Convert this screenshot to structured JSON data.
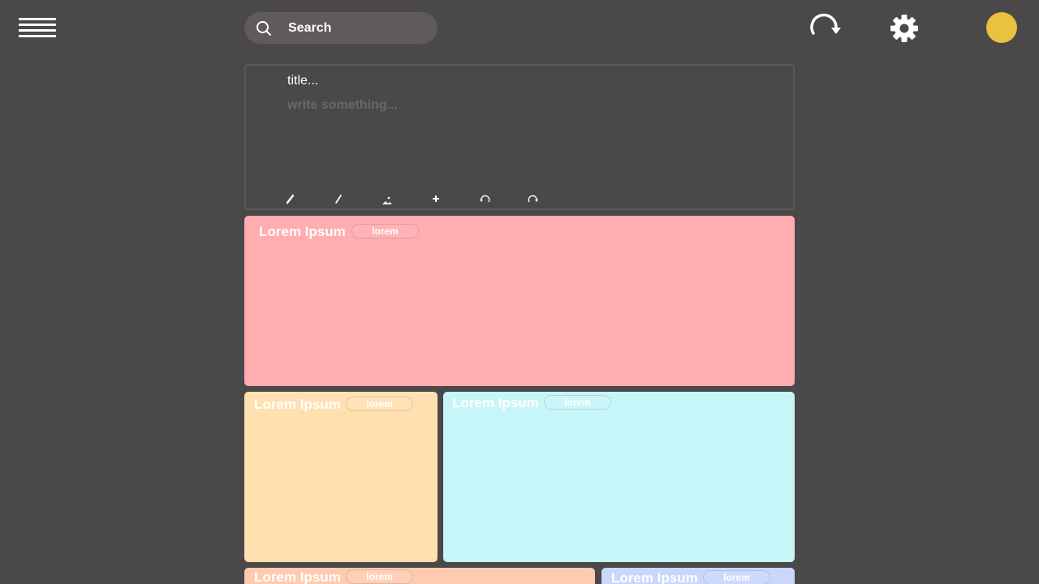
{
  "header": {
    "search_placeholder": "Search"
  },
  "composer": {
    "title_placeholder": "title...",
    "body_placeholder": "write something..."
  },
  "notes": [
    {
      "title": "Lorem Ipsum",
      "tag": "lorem",
      "color": "#ffadb0"
    },
    {
      "title": "Lorem Ipsum",
      "tag": "lorem",
      "color": "#ffe0b0"
    },
    {
      "title": "Lorem Ipsum",
      "tag": "lorem",
      "color": "#c7f6f9"
    },
    {
      "title": "Lorem Ipsum",
      "tag": "lorem",
      "color": "#ffcbb0"
    },
    {
      "title": "Lorem Ipsum",
      "tag": "lorem",
      "color": "#cad7fb"
    }
  ],
  "colors": {
    "background": "#4a4849",
    "search_background": "#5e5b5a",
    "avatar": "#e9c23f"
  },
  "icons": {
    "menu": "menu-icon",
    "search": "search-icon",
    "refresh": "refresh-icon",
    "settings": "gear-icon",
    "toolbar": [
      "pen-icon",
      "pencil-icon",
      "image-icon",
      "plus-icon",
      "undo-icon",
      "redo-icon"
    ]
  }
}
